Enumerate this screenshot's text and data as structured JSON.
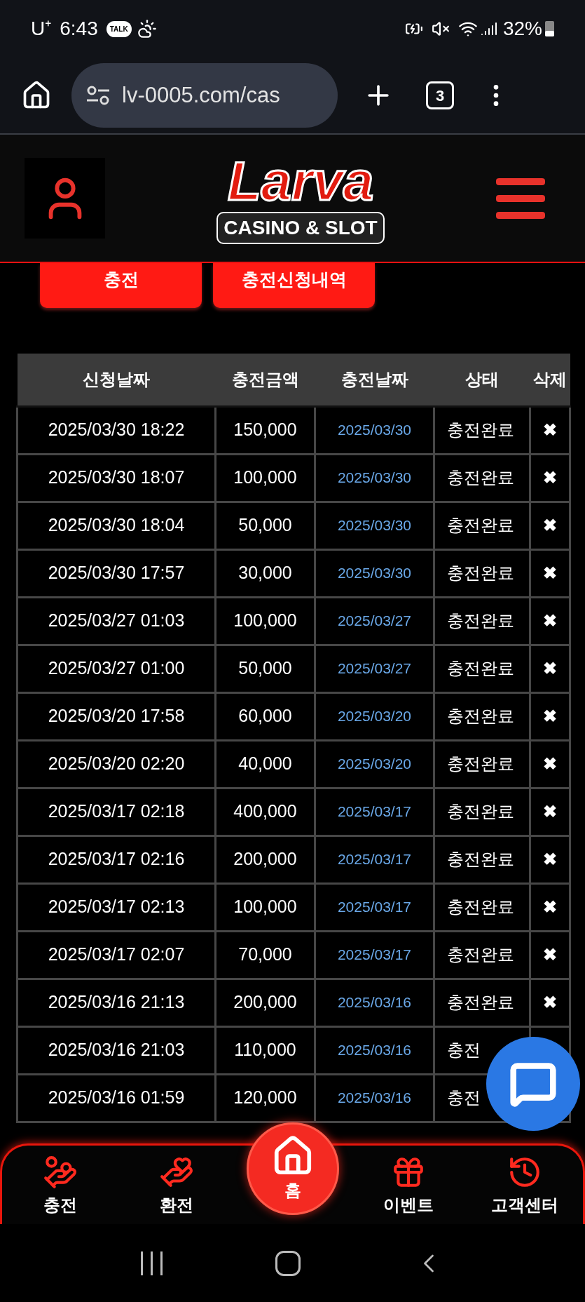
{
  "status_bar": {
    "carrier": "U⁺",
    "time": "6:43",
    "kakao": "TALK",
    "battery": "32%"
  },
  "browser": {
    "url": "lv-0005.com/cas",
    "tab_count": "3"
  },
  "header": {
    "logo_title": "Larva",
    "logo_subtitle": "CASINO & SLOT"
  },
  "action_buttons": [
    "충전",
    "충전신청내역"
  ],
  "table": {
    "columns": [
      "신청날짜",
      "충전금액",
      "충전날짜",
      "상태",
      "삭제"
    ],
    "rows": [
      {
        "requested": "2025/03/30 18:22",
        "amount": "150,000",
        "charged": "2025/03/30",
        "status": "충전완료",
        "delete": "✖"
      },
      {
        "requested": "2025/03/30 18:07",
        "amount": "100,000",
        "charged": "2025/03/30",
        "status": "충전완료",
        "delete": "✖"
      },
      {
        "requested": "2025/03/30 18:04",
        "amount": "50,000",
        "charged": "2025/03/30",
        "status": "충전완료",
        "delete": "✖"
      },
      {
        "requested": "2025/03/30 17:57",
        "amount": "30,000",
        "charged": "2025/03/30",
        "status": "충전완료",
        "delete": "✖"
      },
      {
        "requested": "2025/03/27 01:03",
        "amount": "100,000",
        "charged": "2025/03/27",
        "status": "충전완료",
        "delete": "✖"
      },
      {
        "requested": "2025/03/27 01:00",
        "amount": "50,000",
        "charged": "2025/03/27",
        "status": "충전완료",
        "delete": "✖"
      },
      {
        "requested": "2025/03/20 17:58",
        "amount": "60,000",
        "charged": "2025/03/20",
        "status": "충전완료",
        "delete": "✖"
      },
      {
        "requested": "2025/03/20 02:20",
        "amount": "40,000",
        "charged": "2025/03/20",
        "status": "충전완료",
        "delete": "✖"
      },
      {
        "requested": "2025/03/17 02:18",
        "amount": "400,000",
        "charged": "2025/03/17",
        "status": "충전완료",
        "delete": "✖"
      },
      {
        "requested": "2025/03/17 02:16",
        "amount": "200,000",
        "charged": "2025/03/17",
        "status": "충전완료",
        "delete": "✖"
      },
      {
        "requested": "2025/03/17 02:13",
        "amount": "100,000",
        "charged": "2025/03/17",
        "status": "충전완료",
        "delete": "✖"
      },
      {
        "requested": "2025/03/17 02:07",
        "amount": "70,000",
        "charged": "2025/03/17",
        "status": "충전완료",
        "delete": "✖"
      },
      {
        "requested": "2025/03/16 21:13",
        "amount": "200,000",
        "charged": "2025/03/16",
        "status": "충전완료",
        "delete": "✖"
      },
      {
        "requested": "2025/03/16 21:03",
        "amount": "110,000",
        "charged": "2025/03/16",
        "status": "충전"
      },
      {
        "requested": "2025/03/16 01:59",
        "amount": "120,000",
        "charged": "2025/03/16",
        "status": "충전"
      }
    ]
  },
  "bottom_nav": [
    {
      "label": "충전",
      "kind": "coin-hand"
    },
    {
      "label": "환전",
      "kind": "hands"
    },
    {
      "label": "홈",
      "kind": "home"
    },
    {
      "label": "이벤트",
      "kind": "gift"
    },
    {
      "label": "고객센터",
      "kind": "clock24"
    }
  ]
}
